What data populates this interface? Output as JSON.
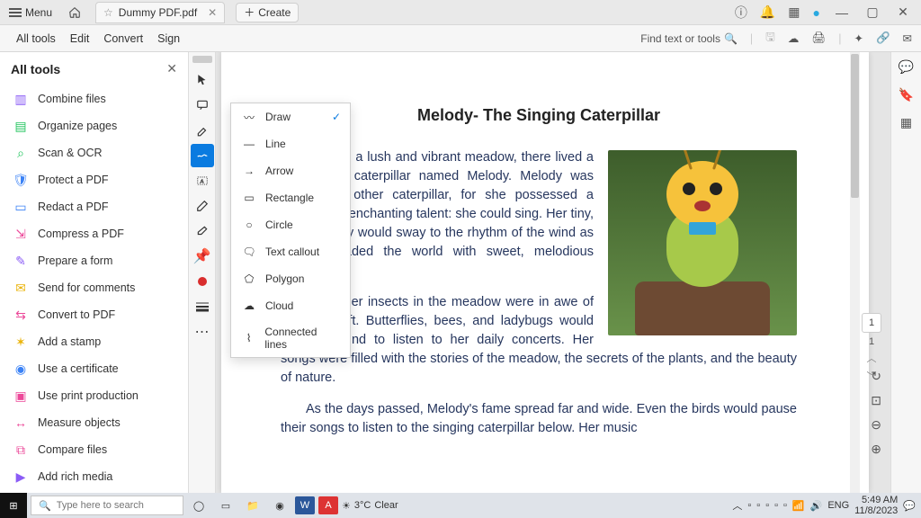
{
  "titlebar": {
    "menu_label": "Menu",
    "tab_title": "Dummy PDF.pdf",
    "create_label": "Create"
  },
  "toolbar": {
    "items": [
      "All tools",
      "Edit",
      "Convert",
      "Sign"
    ],
    "find_label": "Find text or tools"
  },
  "sidebar": {
    "title": "All tools",
    "tools": [
      {
        "label": "Combine files",
        "color": "#8b5cf6",
        "glyph": "▥"
      },
      {
        "label": "Organize pages",
        "color": "#22c55e",
        "glyph": "▤"
      },
      {
        "label": "Scan & OCR",
        "color": "#22c55e",
        "glyph": "⌕"
      },
      {
        "label": "Protect a PDF",
        "color": "#3b82f6",
        "glyph": "🛡"
      },
      {
        "label": "Redact a PDF",
        "color": "#3b82f6",
        "glyph": "▭"
      },
      {
        "label": "Compress a PDF",
        "color": "#ec4899",
        "glyph": "⇲"
      },
      {
        "label": "Prepare a form",
        "color": "#8b5cf6",
        "glyph": "✎"
      },
      {
        "label": "Send for comments",
        "color": "#eab308",
        "glyph": "✉"
      },
      {
        "label": "Convert to PDF",
        "color": "#ec4899",
        "glyph": "⇆"
      },
      {
        "label": "Add a stamp",
        "color": "#eab308",
        "glyph": "✶"
      },
      {
        "label": "Use a certificate",
        "color": "#3b82f6",
        "glyph": "◉"
      },
      {
        "label": "Use print production",
        "color": "#ec4899",
        "glyph": "▣"
      },
      {
        "label": "Measure objects",
        "color": "#ec4899",
        "glyph": "↔"
      },
      {
        "label": "Compare files",
        "color": "#ec4899",
        "glyph": "⧉"
      },
      {
        "label": "Add rich media",
        "color": "#8b5cf6",
        "glyph": "▶"
      }
    ]
  },
  "shapes": {
    "items": [
      {
        "label": "Draw",
        "sel": true
      },
      {
        "label": "Line",
        "sel": false
      },
      {
        "label": "Arrow",
        "sel": false
      },
      {
        "label": "Rectangle",
        "sel": false
      },
      {
        "label": "Circle",
        "sel": false
      },
      {
        "label": "Text callout",
        "sel": false
      },
      {
        "label": "Polygon",
        "sel": false
      },
      {
        "label": "Cloud",
        "sel": false
      },
      {
        "label": "Connected lines",
        "sel": false
      }
    ]
  },
  "doc": {
    "title": "Melody- The Singing Caterpillar",
    "p1": "Once in a lush and vibrant meadow, there lived a remarkable caterpillar named Melody. Melody was unlike any other caterpillar, for she possessed a unique and enchanting talent: she could sing. Her tiny, velvety body would sway to the rhythm of the wind as she serenaded the world with sweet, melodious tunes.",
    "p2": "The other insects in the meadow were in awe of Melody's gift. Butterflies, bees, and ladybugs would gather around to listen to her daily concerts. Her songs were filled with the stories of the meadow, the secrets of the plants, and the beauty of nature.",
    "p3": "As the days passed, Melody's fame spread far and wide. Even the birds would pause their songs to listen to the singing caterpillar below. Her music"
  },
  "pagenav": {
    "current": "1",
    "total": "1"
  },
  "taskbar": {
    "search_placeholder": "Type here to search",
    "weather_temp": "3°C",
    "weather_cond": "Clear",
    "lang": "ENG",
    "time": "5:49 AM",
    "date": "11/8/2023"
  }
}
